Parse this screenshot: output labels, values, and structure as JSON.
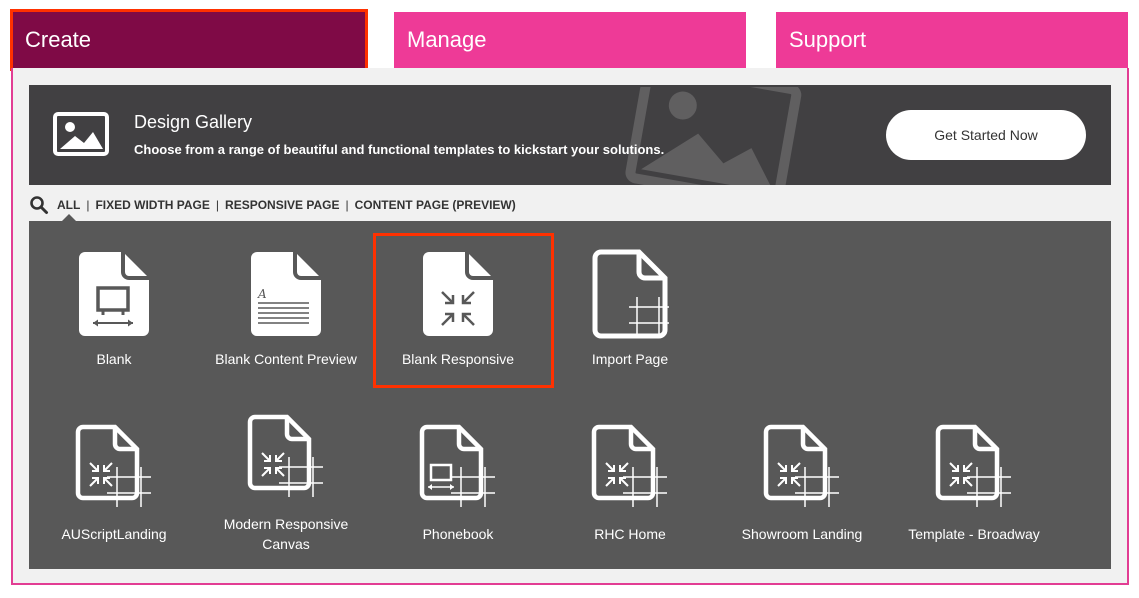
{
  "tabs": {
    "create": "Create",
    "manage": "Manage",
    "support": "Support"
  },
  "banner": {
    "title": "Design Gallery",
    "description": "Choose from a range of beautiful and functional templates to kickstart your solutions.",
    "button_label": "Get Started Now",
    "icon": "image-icon"
  },
  "filters": {
    "icon": "search-icon",
    "items": [
      "ALL",
      "FIXED WIDTH PAGE",
      "RESPONSIVE PAGE",
      "CONTENT PAGE (PREVIEW)"
    ],
    "separator": "|",
    "active": "ALL"
  },
  "templates": [
    {
      "label": "Blank",
      "icon": "fixed-width-page-icon"
    },
    {
      "label": "Blank Content Preview",
      "icon": "content-page-icon"
    },
    {
      "label": "Blank Responsive",
      "icon": "responsive-page-icon"
    },
    {
      "label": "Import Page",
      "icon": "import-page-icon"
    },
    {
      "label": "AUScriptLanding",
      "icon": "responsive-template-icon"
    },
    {
      "label": "Modern Responsive Canvas",
      "icon": "responsive-template-icon"
    },
    {
      "label": "Phonebook",
      "icon": "fixed-width-template-icon"
    },
    {
      "label": "RHC Home",
      "icon": "responsive-template-icon"
    },
    {
      "label": "Showroom Landing",
      "icon": "responsive-template-icon"
    },
    {
      "label": "Template - Broadway",
      "icon": "responsive-template-icon"
    }
  ],
  "colors": {
    "active_tab": "#7f0a46",
    "tab": "#ee3a97",
    "banner_bg": "#414042",
    "gallery_bg": "#585858",
    "highlight": "#ff3100"
  }
}
